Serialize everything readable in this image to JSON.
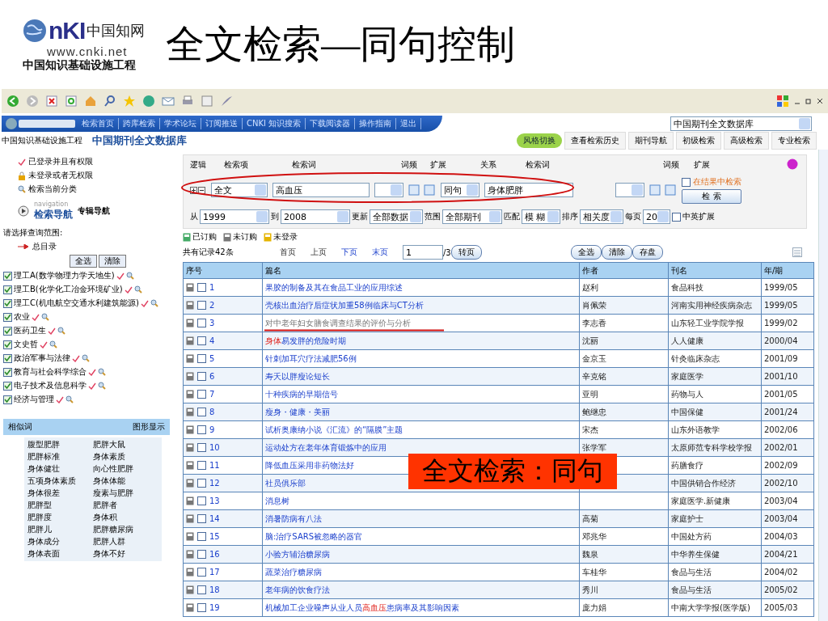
{
  "slide": {
    "title": "全文检索—同句控制",
    "logo": {
      "mark": "nKI",
      "name": "中国知网",
      "url": "www.cnki.net",
      "tagline": "中国知识基础设施工程"
    }
  },
  "site": {
    "tagline": "中国知识基础设施工程",
    "nav_links": [
      "检索首页",
      "跨库检索",
      "学术论坛",
      "订阅推送",
      "CNKI 知识搜索",
      "下载阅读器",
      "操作指南",
      "退出"
    ],
    "db_select": "中国期刊全文数据库",
    "db_title": "中国期刊全文数据库",
    "style_button": "风格切换",
    "tabs": [
      "查看检索历史",
      "期刊导航",
      "初级检索",
      "高级检索",
      "专业检索"
    ]
  },
  "sidebar": {
    "legend": [
      {
        "kind": "ok",
        "label": "已登录并且有权限"
      },
      {
        "kind": "lock",
        "label": "未登录或者无权限"
      },
      {
        "kind": "search",
        "label": "检索当前分类"
      }
    ],
    "nav_small": "navigation",
    "nav_main": "检索导航",
    "nav_alt": "专辑导航",
    "scope_label": "请选择查询范围:",
    "root": "总目录",
    "buttons": [
      "全选",
      "清除"
    ],
    "categories": [
      {
        "label": "理工A(数学物理力学天地生)",
        "checked": true
      },
      {
        "label": "理工B(化学化工冶金环境矿业)",
        "checked": true
      },
      {
        "label": "理工C(机电航空交通水利建筑能源)",
        "checked": true
      },
      {
        "label": "农业",
        "checked": true
      },
      {
        "label": "医药卫生",
        "checked": true
      },
      {
        "label": "文史哲",
        "checked": true
      },
      {
        "label": "政治军事与法律",
        "checked": true
      },
      {
        "label": "教育与社会科学综合",
        "checked": true
      },
      {
        "label": "电子技术及信息科学",
        "checked": true
      },
      {
        "label": "经济与管理",
        "checked": true
      }
    ],
    "similar_title": "相似词",
    "similar_link": "图形显示",
    "similar_words": [
      "腹型肥胖",
      "肥胖大鼠",
      "肥胖标准",
      "身体素质",
      "身体健壮",
      "向心性肥胖",
      "五项身体素质",
      "身体体能",
      "身体很差",
      "瘦素与肥胖",
      "肥胖型",
      "肥胖者",
      "肥胖度",
      "身体积",
      "肥胖儿",
      "肥胖糖尿病",
      "身体成分",
      "肥胖人群",
      "身体表面",
      "身体不好"
    ]
  },
  "search": {
    "labels": [
      "逻辑",
      "检索项",
      "检索词",
      "词频",
      "扩展",
      "关系",
      "检索词",
      "词频",
      "扩展"
    ],
    "field": "全文",
    "term1": "高血压",
    "relation": "同句",
    "term2": "身体肥胖",
    "in_results": {
      "label": "在结果中检索",
      "checked": false
    },
    "search_button": "检 索",
    "from_label": "从",
    "from": "1999",
    "to_label": "到",
    "to": "2008",
    "update_label": "更新",
    "update": "全部数据",
    "range_label": "范围",
    "range": "全部期刊",
    "match_label": "匹配",
    "match": "模 糊",
    "sort_label": "排序",
    "sort": "相关度",
    "per_page_label": "每页",
    "per_page": "20",
    "cn_en": {
      "label": "中英扩展",
      "checked": false
    }
  },
  "legend": [
    {
      "kind": "bought",
      "label": "已订购"
    },
    {
      "kind": "unbought",
      "label": "未订购"
    },
    {
      "kind": "nologin",
      "label": "未登录"
    }
  ],
  "results": {
    "count": "共有记录42条",
    "pager": [
      {
        "label": "首页",
        "disabled": true
      },
      {
        "label": "上页",
        "disabled": true
      },
      {
        "label": "下页",
        "disabled": false
      },
      {
        "label": "末页",
        "disabled": false
      }
    ],
    "page": "1",
    "pages": "/3",
    "go": "转页",
    "actions": [
      "全选",
      "清除",
      "存盘"
    ]
  },
  "table": {
    "columns": [
      "序号",
      "篇名",
      "作者",
      "刊名",
      "年/期"
    ],
    "rows": [
      {
        "no": "1",
        "title": [
          {
            "t": "果胶的制备及其在食品工业的应用综述",
            "hit": false
          }
        ],
        "visited": false,
        "checked": false,
        "author": "赵利",
        "journal": "食品科技",
        "issue": "1999/05"
      },
      {
        "no": "2",
        "title": [
          {
            "t": "壳核出血治疗后症状加重58例临床与CT分析",
            "hit": false
          }
        ],
        "visited": false,
        "checked": false,
        "author": "肖佩荣",
        "journal": "河南实用神经疾病杂志",
        "issue": "1999/05"
      },
      {
        "no": "3",
        "title": [
          {
            "t": "对中老年妇女膳食调查结果的评价与分析",
            "hit": false
          }
        ],
        "visited": true,
        "checked": false,
        "author": "李志香",
        "journal": "山东轻工业学院学报",
        "issue": "1999/02"
      },
      {
        "no": "4",
        "title": [
          {
            "t": "身体",
            "hit": true
          },
          {
            "t": "易发胖的危险时期",
            "hit": false
          }
        ],
        "visited": false,
        "checked": false,
        "author": "沈丽",
        "journal": "人人健康",
        "issue": "2000/04"
      },
      {
        "no": "5",
        "title": [
          {
            "t": "针刺加耳穴疗法减肥56例",
            "hit": false
          }
        ],
        "visited": false,
        "checked": false,
        "author": "金京玉",
        "journal": "针灸临床杂志",
        "issue": "2001/09"
      },
      {
        "no": "6",
        "title": [
          {
            "t": "寿夭以胖瘦论短长",
            "hit": false
          }
        ],
        "visited": false,
        "checked": false,
        "author": "辛克铭",
        "journal": "家庭医学",
        "issue": "2001/10"
      },
      {
        "no": "7",
        "title": [
          {
            "t": "十种疾病的早期信号",
            "hit": false
          }
        ],
        "visited": false,
        "checked": false,
        "author": "亚明",
        "journal": "药物与人",
        "issue": "2001/05"
      },
      {
        "no": "8",
        "title": [
          {
            "t": "瘦身・健康・美丽",
            "hit": false
          }
        ],
        "visited": false,
        "checked": false,
        "author": "鲍继忠",
        "journal": "中国保健",
        "issue": "2001/24"
      },
      {
        "no": "9",
        "title": [
          {
            "t": "试析奥康纳小说《汇流》的“隔膜”主题",
            "hit": false
          }
        ],
        "visited": false,
        "checked": false,
        "author": "宋杰",
        "journal": "山东外语教学",
        "issue": "2002/06"
      },
      {
        "no": "10",
        "title": [
          {
            "t": "运动处方在老年体育锻炼中的应用",
            "hit": false
          }
        ],
        "visited": false,
        "checked": false,
        "author": "张学军",
        "journal": "太原师范专科学校学报",
        "issue": "2002/01"
      },
      {
        "no": "11",
        "title": [
          {
            "t": "降低血压采用非药物法好",
            "hit": false
          }
        ],
        "visited": false,
        "checked": false,
        "journal": "药膳食疗",
        "issue": "2002/09"
      },
      {
        "no": "12",
        "title": [
          {
            "t": "社员俱乐部",
            "hit": false
          }
        ],
        "visited": false,
        "checked": false,
        "journal": "中国供销合作经济",
        "issue": "2002/10"
      },
      {
        "no": "13",
        "title": [
          {
            "t": "消息树",
            "hit": false
          }
        ],
        "visited": false,
        "checked": false,
        "journal": "家庭医学.新健康",
        "issue": "2003/04"
      },
      {
        "no": "14",
        "title": [
          {
            "t": "消暑防病有八法",
            "hit": false
          }
        ],
        "visited": false,
        "checked": false,
        "author": "高菊",
        "journal": "家庭护士",
        "issue": "2003/04"
      },
      {
        "no": "15",
        "title": [
          {
            "t": "脑:治疗SARS被忽略的器官",
            "hit": false
          }
        ],
        "visited": false,
        "checked": false,
        "author": "邓兆华",
        "journal": "中国处方药",
        "issue": "2004/03"
      },
      {
        "no": "16",
        "title": [
          {
            "t": "小验方辅治糖尿病",
            "hit": false
          }
        ],
        "visited": false,
        "checked": false,
        "author": "魏泉",
        "journal": "中华养生保健",
        "issue": "2004/21"
      },
      {
        "no": "17",
        "title": [
          {
            "t": "蔬菜治疗糖尿病",
            "hit": false
          }
        ],
        "visited": false,
        "checked": false,
        "author": "车桂华",
        "journal": "食品与生活",
        "issue": "2004/02"
      },
      {
        "no": "18",
        "title": [
          {
            "t": "老年病的饮食疗法",
            "hit": false
          }
        ],
        "visited": false,
        "checked": false,
        "author": "秀川",
        "journal": "食品与生活",
        "issue": "2005/02"
      },
      {
        "no": "19",
        "title": [
          {
            "t": "机械加工企业噪声从业人员",
            "hit": false
          },
          {
            "t": "高血压",
            "hit": true
          },
          {
            "t": "患病率及其影响因素",
            "hit": false
          }
        ],
        "visited": false,
        "checked": false,
        "author": "庞力娟",
        "journal": "中南大学学报(医学版)",
        "issue": "2005/03"
      }
    ]
  },
  "callout": "全文检索：同句"
}
